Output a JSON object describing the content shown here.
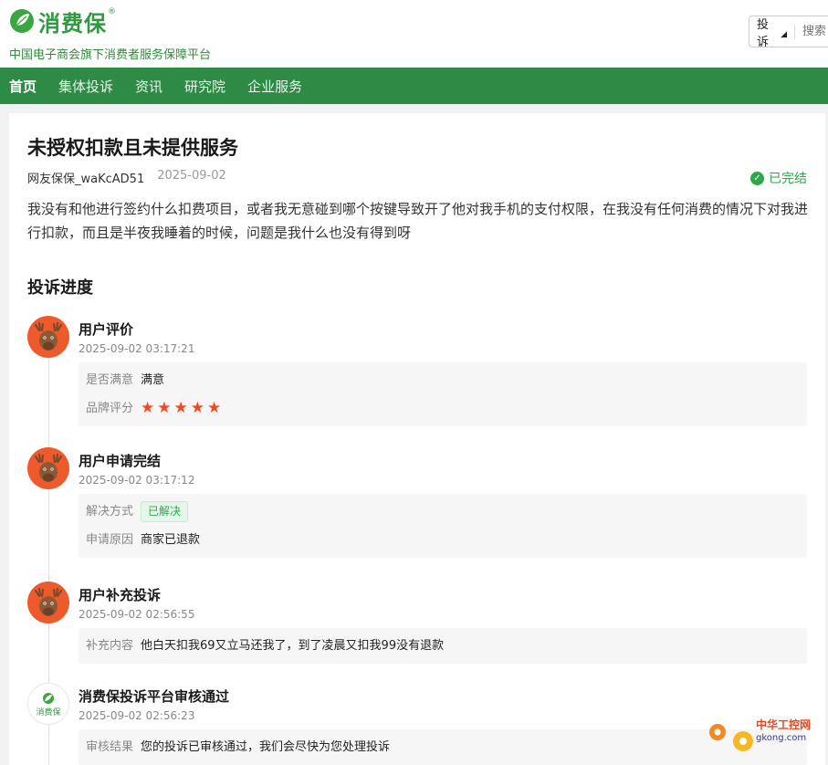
{
  "header": {
    "brand": "消费保",
    "brand_mark": "®",
    "slogan": "中国电子商会旗下消费者服务保障平台",
    "search_type": "投诉",
    "search_placeholder": "搜索"
  },
  "nav": {
    "items": [
      "首页",
      "集体投诉",
      "资讯",
      "研究院",
      "企业服务"
    ],
    "active": "首页"
  },
  "complaint": {
    "title": "未授权扣款且未提供服务",
    "author": "网友保保_waKcAD51",
    "date": "2025-09-02",
    "status": "已完结",
    "description": "我没有和他进行签约什么扣费项目，或者我无意碰到哪个按键导致开了他对我手机的支付权限，在我没有任何消费的情况下对我进行扣款，而且是半夜我睡着的时候，问题是我什么也没有得到呀"
  },
  "progress": {
    "title": "投诉进度",
    "items": [
      {
        "title": "用户评价",
        "time": "2025-09-02 03:17:21",
        "rows": [
          {
            "label": "是否满意",
            "value": "满意"
          },
          {
            "label": "品牌评分",
            "rating": 5
          }
        ]
      },
      {
        "title": "用户申请完结",
        "time": "2025-09-02 03:17:12",
        "rows": [
          {
            "label": "解决方式",
            "tag": "已解决"
          },
          {
            "label": "申请原因",
            "value": "商家已退款"
          }
        ]
      },
      {
        "title": "用户补充投诉",
        "time": "2025-09-02 02:56:55",
        "rows": [
          {
            "label": "补充内容",
            "value": "他白天扣我69又立马还我了，到了凌晨又扣我99没有退款"
          }
        ]
      },
      {
        "title": "消费保投诉平台审核通过",
        "time": "2025-09-02 02:56:23",
        "avatar_text": "消费保",
        "rows": [
          {
            "label": "审核结果",
            "value": "您的投诉已审核通过，我们会尽快为您处理投诉"
          }
        ]
      }
    ]
  },
  "watermark": {
    "text": "中华工控网",
    "domain": "gkong.com"
  },
  "colors": {
    "brand_green": "#2e8b46",
    "status_green": "#2fa64e",
    "star_orange": "#ef4a22",
    "avatar_orange": "#ef5a2c"
  }
}
